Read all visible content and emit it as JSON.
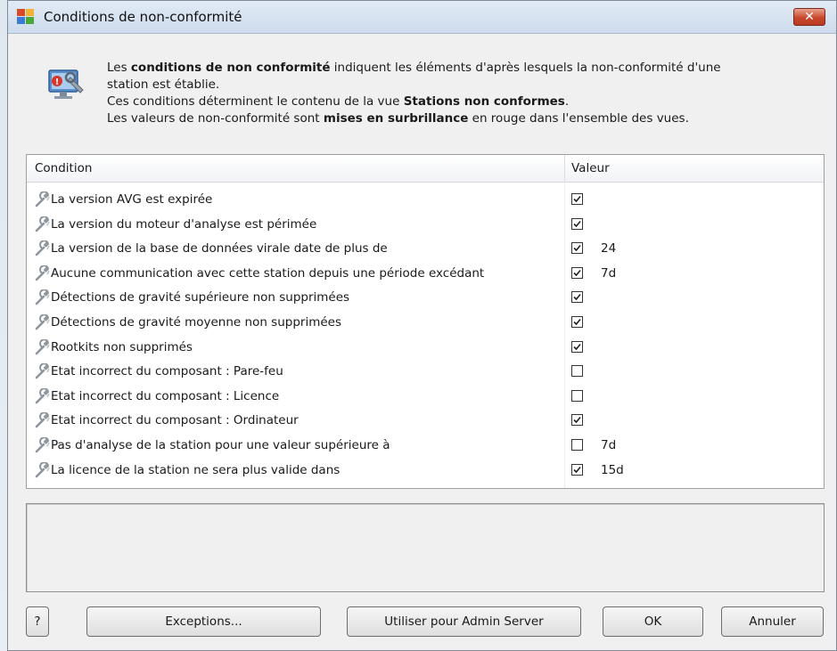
{
  "window": {
    "title": "Conditions de non-conformité",
    "close_label": "✕"
  },
  "info": {
    "line1_a": "Les ",
    "line1_bold": "conditions de non conformité",
    "line1_b": " indiquent les éléments d'après lesquels la non-conformité d'une",
    "line2": "station est établie.",
    "line3_a": "Ces conditions déterminent le contenu de la vue ",
    "line3_bold": "Stations non conformes",
    "line3_b": ".",
    "line4_a": "Les valeurs de non-conformité sont ",
    "line4_bold": "mises en surbrillance",
    "line4_b": " en rouge dans l'ensemble des vues."
  },
  "table": {
    "headers": {
      "condition": "Condition",
      "value": "Valeur"
    },
    "rows": [
      {
        "condition": "La version AVG est expirée",
        "checked": true,
        "value": ""
      },
      {
        "condition": "La version du moteur d'analyse est périmée",
        "checked": true,
        "value": ""
      },
      {
        "condition": "La version de la base de données virale date de plus de",
        "checked": true,
        "value": "24"
      },
      {
        "condition": "Aucune communication avec cette station depuis une période excédant",
        "checked": true,
        "value": "7d"
      },
      {
        "condition": "Détections de gravité supérieure non supprimées",
        "checked": true,
        "value": ""
      },
      {
        "condition": "Détections de gravité moyenne non supprimées",
        "checked": true,
        "value": ""
      },
      {
        "condition": "Rootkits non supprimés",
        "checked": true,
        "value": ""
      },
      {
        "condition": "Etat incorrect du composant : Pare-feu",
        "checked": false,
        "value": ""
      },
      {
        "condition": "Etat incorrect du composant : Licence",
        "checked": false,
        "value": ""
      },
      {
        "condition": "Etat incorrect du composant : Ordinateur",
        "checked": true,
        "value": ""
      },
      {
        "condition": "Pas d'analyse de la station pour une valeur supérieure à",
        "checked": false,
        "value": "7d"
      },
      {
        "condition": "La licence de la station ne sera plus valide dans",
        "checked": true,
        "value": "15d"
      }
    ]
  },
  "description": "",
  "buttons": {
    "help": "?",
    "exceptions": "Exceptions...",
    "admin_server": "Utiliser pour Admin Server",
    "ok": "OK",
    "cancel": "Annuler"
  },
  "icons": {
    "app": "avg-logo-icon",
    "info": "computer-settings-icon",
    "row": "wrench-icon",
    "check": "checkmark-icon"
  }
}
